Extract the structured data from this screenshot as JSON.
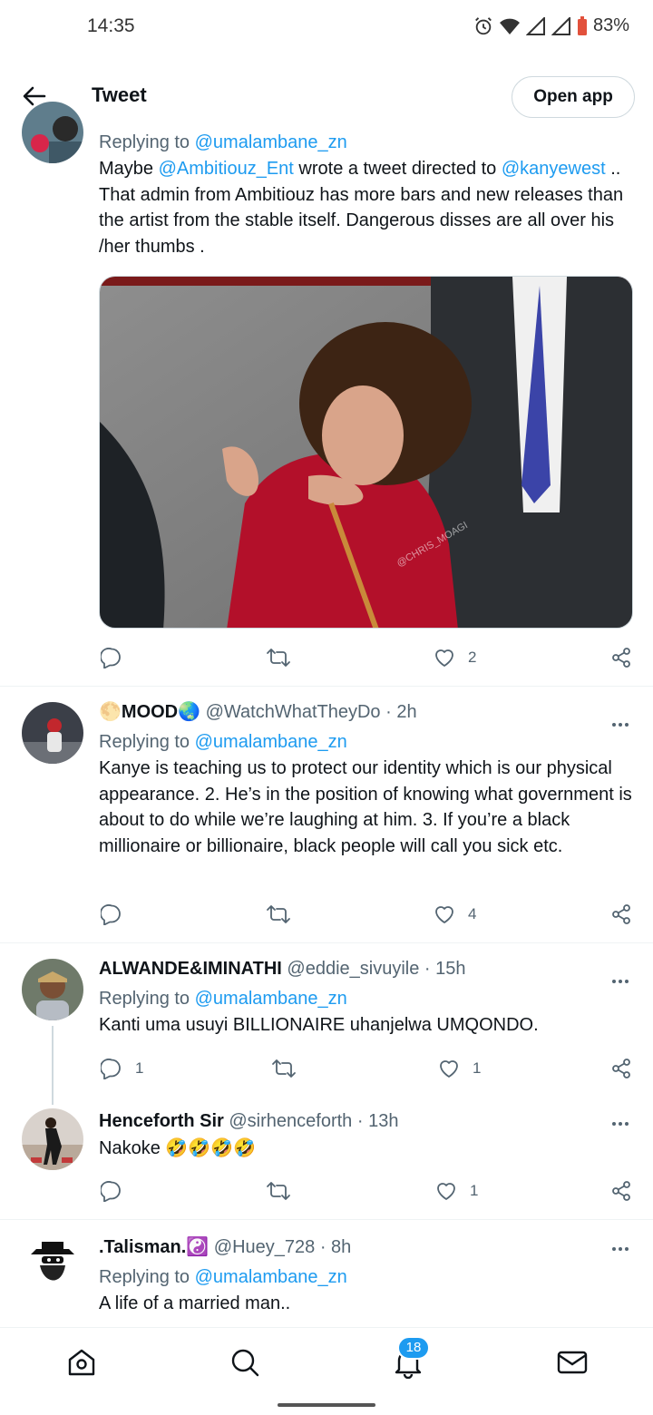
{
  "status": {
    "time": "14:35",
    "battery": "83%"
  },
  "topbar": {
    "title": "Tweet",
    "open_app": "Open app"
  },
  "tweets": [
    {
      "reply_prefix": "Replying to ",
      "reply_to": "@umalambane_zn",
      "text_parts": {
        "a": "Maybe ",
        "m1": "@Ambitiouz_Ent",
        "b": " wrote a tweet directed to ",
        "m2": "@kanyewest",
        "c": " .. That admin from Ambitiouz has more bars and new releases than the artist from the stable itself.  Dangerous disses are all over his /her thumbs ."
      },
      "image_watermark": "@CHRIS_MOAGI",
      "likes": "2"
    },
    {
      "name": "MOOD",
      "handle": "@WatchWhatTheyDo",
      "time": "· 2h",
      "reply_prefix": "Replying to ",
      "reply_to": "@umalambane_zn",
      "text": "Kanye is teaching us to protect our identity which is our physical appearance. 2. He’s in the position of knowing what government is about to do while we’re laughing at him. 3. If you’re a black millionaire or billionaire, black people will call you sick etc.",
      "likes": "4"
    },
    {
      "name": "ALWANDE&IMINATHI",
      "handle": "@eddie_sivuyile",
      "time": "· 15h",
      "reply_prefix": "Replying to ",
      "reply_to": "@umalambane_zn",
      "text": "Kanti uma usuyi BILLIONAIRE uhanjelwa UMQONDO.",
      "replies": "1",
      "likes": "1"
    },
    {
      "name": "Henceforth Sir",
      "handle": "@sirhenceforth",
      "time": "· 13h",
      "text": "Nakoke",
      "emoji": "🤣🤣🤣🤣",
      "likes": "1"
    },
    {
      "name": ".Talisman.",
      "handle": "@Huey_728",
      "time": "· 8h",
      "reply_prefix": "Replying to ",
      "reply_to": "@umalambane_zn",
      "text": "A life of a married man.."
    }
  ],
  "nav": {
    "notifications_badge": "18"
  },
  "icons": [
    "back-arrow-icon",
    "reply-icon",
    "retweet-icon",
    "like-icon",
    "share-icon",
    "more-icon",
    "home-icon",
    "search-icon",
    "bell-icon",
    "mail-icon"
  ]
}
